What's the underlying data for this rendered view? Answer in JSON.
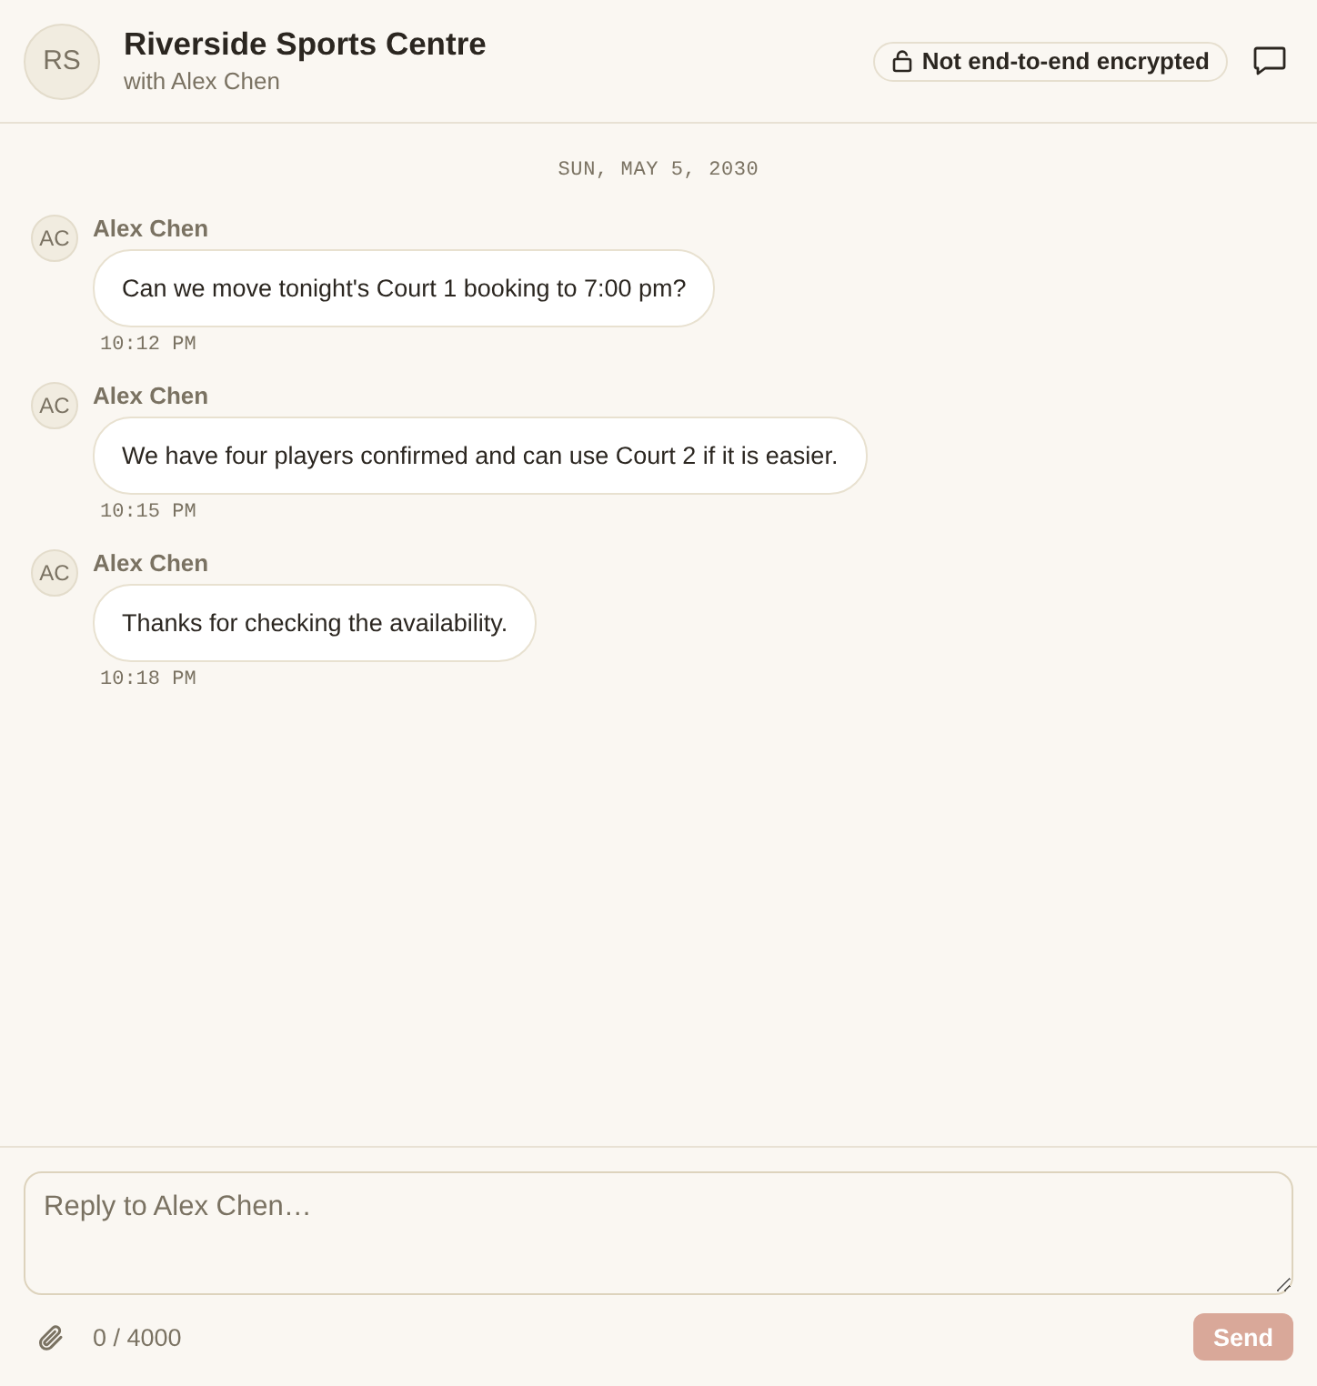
{
  "header": {
    "avatar_initials": "RS",
    "title": "Riverside Sports Centre",
    "subtitle": "with Alex Chen",
    "encryption_badge": "Not end-to-end encrypted"
  },
  "date_divider": "SUN, MAY 5, 2030",
  "messages": [
    {
      "avatar_initials": "AC",
      "sender": "Alex Chen",
      "text": "Can we move tonight's Court 1 booking to 7:00 pm?",
      "time": "10:12 PM"
    },
    {
      "avatar_initials": "AC",
      "sender": "Alex Chen",
      "text": "We have four players confirmed and can use Court 2 if it is easier.",
      "time": "10:15 PM"
    },
    {
      "avatar_initials": "AC",
      "sender": "Alex Chen",
      "text": "Thanks for checking the availability.",
      "time": "10:18 PM"
    }
  ],
  "composer": {
    "placeholder": "Reply to Alex Chen…",
    "char_count": "0 / 4000",
    "send_button": {
      "label": "Send",
      "disabled": true
    }
  }
}
